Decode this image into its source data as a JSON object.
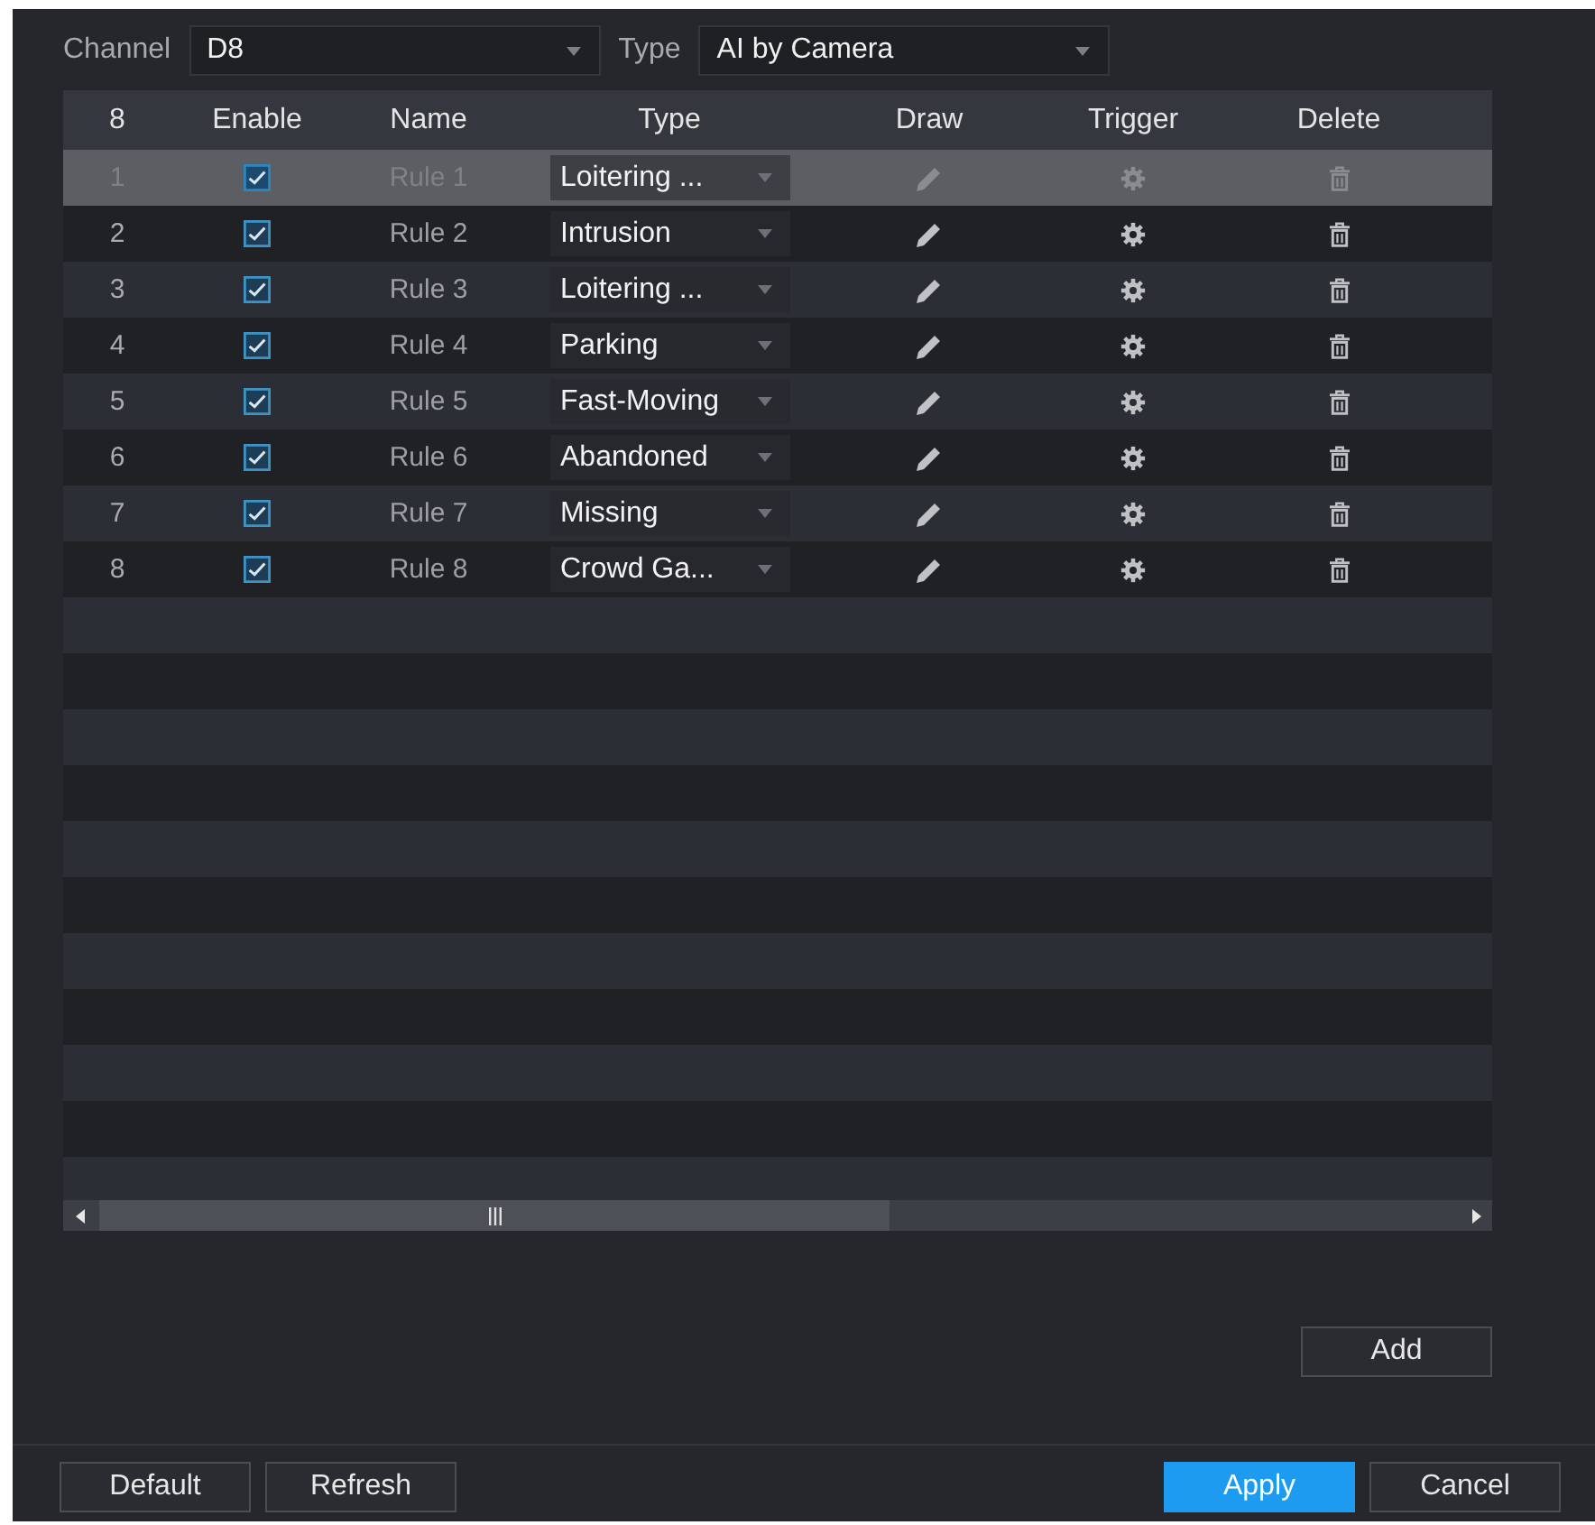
{
  "filters": [
    {
      "label": "Channel",
      "value": "D8"
    },
    {
      "label": "Type",
      "value": "AI by Camera"
    }
  ],
  "table": {
    "columns": [
      "8",
      "Enable",
      "Name",
      "Type",
      "Draw",
      "Trigger",
      "Delete"
    ],
    "rows": [
      {
        "number": "1",
        "enabled": true,
        "name": "Rule 1",
        "type": "Loitering ...",
        "selected": true
      },
      {
        "number": "2",
        "enabled": true,
        "name": "Rule 2",
        "type": "Intrusion",
        "selected": false
      },
      {
        "number": "3",
        "enabled": true,
        "name": "Rule 3",
        "type": "Loitering ...",
        "selected": false
      },
      {
        "number": "4",
        "enabled": true,
        "name": "Rule 4",
        "type": "Parking",
        "selected": false
      },
      {
        "number": "5",
        "enabled": true,
        "name": "Rule 5",
        "type": "Fast-Moving",
        "selected": false
      },
      {
        "number": "6",
        "enabled": true,
        "name": "Rule 6",
        "type": "Abandoned",
        "selected": false
      },
      {
        "number": "7",
        "enabled": true,
        "name": "Rule 7",
        "type": "Missing",
        "selected": false
      },
      {
        "number": "8",
        "enabled": true,
        "name": "Rule 8",
        "type": "Crowd Ga...",
        "selected": false
      }
    ]
  },
  "add_button": {
    "label": "Add"
  },
  "footer": {
    "left_buttons": [
      {
        "label": "Default",
        "kind": "plain"
      },
      {
        "label": "Refresh",
        "kind": "plain"
      }
    ],
    "right_buttons": [
      {
        "label": "Apply",
        "kind": "primary"
      },
      {
        "label": "Cancel",
        "kind": "plain"
      }
    ]
  }
}
